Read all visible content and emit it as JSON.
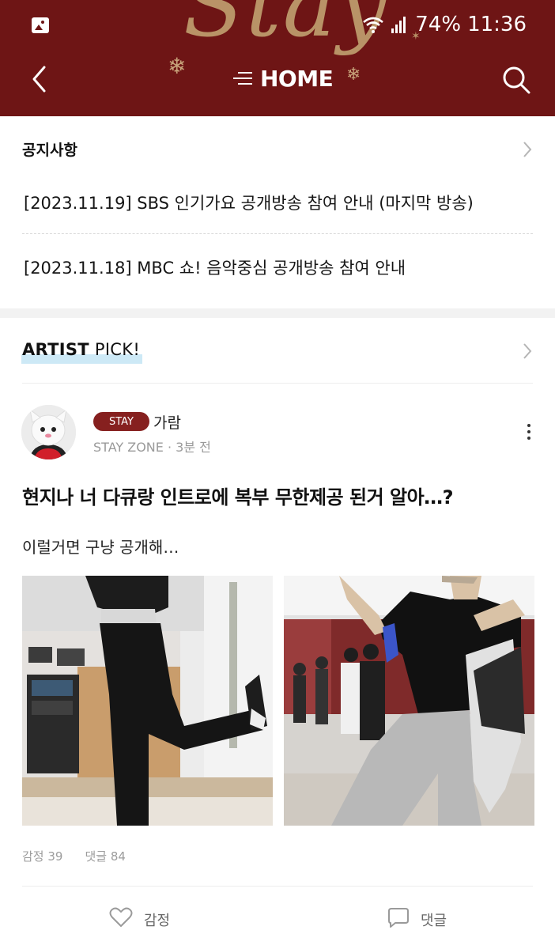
{
  "header": {
    "wordmark": "Stay",
    "title": "HOME"
  },
  "status_bar": {
    "battery": "74%",
    "time": "11:36"
  },
  "notices": {
    "title": "공지사항",
    "items": [
      "[2023.11.19] SBS 인기가요 공개방송 참여 안내 (마지막 방송)",
      "[2023.11.18] MBC 쇼! 음악중심 공개방송 참여 안내"
    ]
  },
  "artist_pick": {
    "title_bold": "ARTIST",
    "title_rest": " PICK!"
  },
  "post": {
    "badge": "STAY",
    "author": "가람",
    "board": "STAY ZONE",
    "time_ago": "3분 전",
    "title": "현지나 너 다큐랑 인트로에 복부 무한제공 된거 알아…?",
    "body": "이럴거면 구냥 공개해…",
    "stats": {
      "likes": "감정 39",
      "comments": "댓글 84"
    },
    "actions": {
      "like": "감정",
      "comment": "댓글"
    }
  },
  "colors": {
    "header_bg": "#6e1515",
    "accent_gold": "#b99367",
    "badge_bg": "#86201f",
    "pick_highlight": "#cde9f6"
  },
  "icons": [
    "gallery-icon",
    "wifi-icon",
    "signal-icon",
    "back-icon",
    "menu-lines-icon",
    "search-icon",
    "snowflake-icon",
    "chevron-right-icon",
    "more-vertical-icon",
    "heart-icon",
    "comment-bubble-icon"
  ]
}
